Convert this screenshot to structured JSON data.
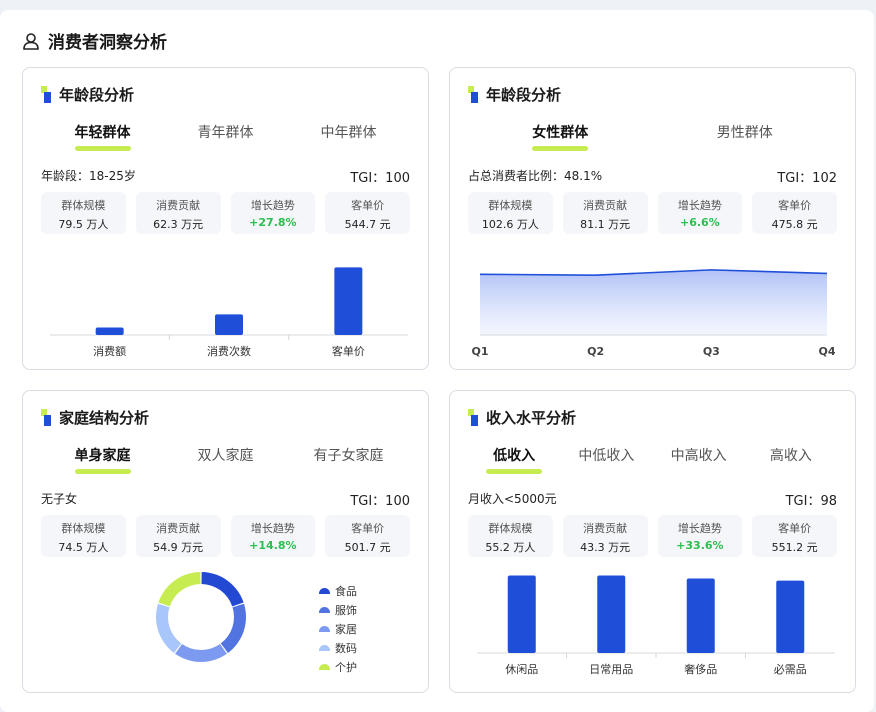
{
  "page": {
    "title": "消费者洞察分析"
  },
  "stat_labels": {
    "scale": "群体规模",
    "contribution": "消费贡献",
    "trend": "增长趋势",
    "avg_price": "客单价"
  },
  "cards": {
    "age": {
      "title": "年龄段分析",
      "tabs": [
        "年轻群体",
        "青年群体",
        "中年群体"
      ],
      "meta_left": "年龄段：18-25岁",
      "tgi": "TGI：100",
      "stats": {
        "scale": "79.5 万人",
        "contribution": "62.3 万元",
        "trend": "+27.8%",
        "avg_price": "544.7 元"
      }
    },
    "gender": {
      "title": "年龄段分析",
      "tabs": [
        "女性群体",
        "男性群体"
      ],
      "meta_left": "占总消费者比例：48.1%",
      "tgi": "TGI：102",
      "stats": {
        "scale": "102.6 万人",
        "contribution": "81.1 万元",
        "trend": "+6.6%",
        "avg_price": "475.8 元"
      }
    },
    "family": {
      "title": "家庭结构分析",
      "tabs": [
        "单身家庭",
        "双人家庭",
        "有子女家庭"
      ],
      "meta_left": "无子女",
      "tgi": "TGI：100",
      "stats": {
        "scale": "74.5 万人",
        "contribution": "54.9 万元",
        "trend": "+14.8%",
        "avg_price": "501.7 元"
      }
    },
    "income": {
      "title": "收入水平分析",
      "tabs": [
        "低收入",
        "中低收入",
        "中高收入",
        "高收入"
      ],
      "meta_left": "月收入<5000元",
      "tgi": "TGI：98",
      "stats": {
        "scale": "55.2 万人",
        "contribution": "43.3 万元",
        "trend": "+33.6%",
        "avg_price": "551.2 元"
      }
    }
  },
  "colors": {
    "accent_blue": "#1f4fd8",
    "tab_underline": "#c6ec52",
    "trend_green": "#2cbe4e"
  },
  "chart_data": [
    {
      "type": "bar",
      "categories": [
        "消费额",
        "消费次数",
        "客单价"
      ],
      "values": [
        8,
        22,
        72
      ],
      "color": "#1f4fd8"
    },
    {
      "type": "area",
      "x": [
        "Q1",
        "Q2",
        "Q3",
        "Q4"
      ],
      "values": [
        69,
        68,
        74,
        70
      ],
      "color": "#1f4fd8"
    },
    {
      "type": "pie",
      "donut": true,
      "categories": [
        "食品",
        "服饰",
        "家居",
        "数码",
        "个护"
      ],
      "values": [
        20,
        20,
        20,
        20,
        20
      ],
      "colors": [
        "#2349d3",
        "#5174e0",
        "#7c9bf0",
        "#a9c6fb",
        "#c6ec52"
      ]
    },
    {
      "type": "bar",
      "categories": [
        "休闲品",
        "日常用品",
        "奢侈品",
        "必需品"
      ],
      "values": [
        76,
        76,
        73,
        71
      ],
      "color": "#1f4fd8"
    }
  ]
}
